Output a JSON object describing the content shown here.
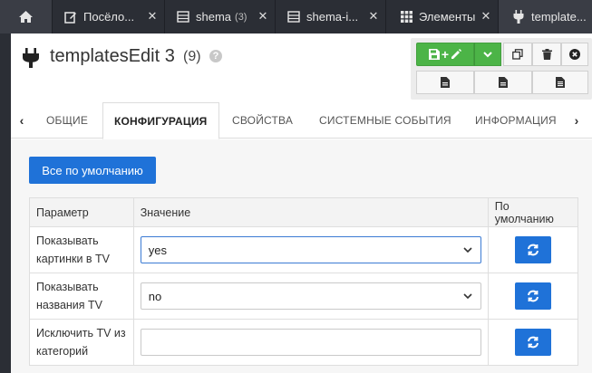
{
  "tabs": [
    {
      "title": "Посёло...",
      "icon": "edit-icon"
    },
    {
      "title": "shema",
      "count": "(3)",
      "icon": "table-icon"
    },
    {
      "title": "shema-i...",
      "icon": "table-icon"
    },
    {
      "title": "Элементы",
      "icon": "grid-icon"
    },
    {
      "title": "template...",
      "icon": "plug-icon"
    }
  ],
  "header": {
    "title": "templatesEdit 3",
    "count": "(9)",
    "help": "?"
  },
  "subtabs": [
    "ОБЩИЕ",
    "КОНФИГУРАЦИЯ",
    "СВОЙСТВА",
    "СИСТЕМНЫЕ СОБЫТИЯ",
    "ИНФОРМАЦИЯ"
  ],
  "active_subtab": "КОНФИГУРАЦИЯ",
  "default_button": "Все по умолчанию",
  "table": {
    "headers": [
      "Параметр",
      "Значение",
      "По умолчанию"
    ],
    "rows": [
      {
        "name": "Показывать картинки в TV",
        "value": "yes"
      },
      {
        "name": "Показывать названия TV",
        "value": "no"
      },
      {
        "name": "Исключить TV из категорий",
        "value": ""
      }
    ]
  },
  "colors": {
    "accent": "#1f72d8",
    "save_green": "#4cb447",
    "topbar": "#2b2e35"
  }
}
